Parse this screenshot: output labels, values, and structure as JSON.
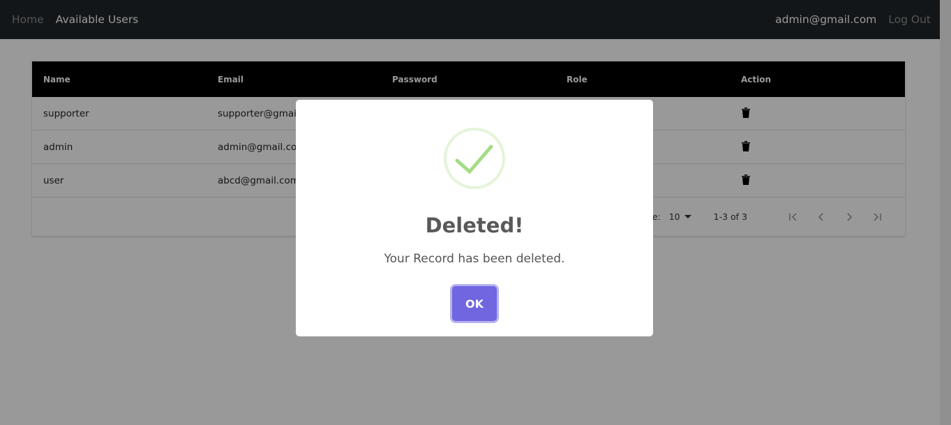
{
  "nav": {
    "home": "Home",
    "available_users": "Available Users",
    "user_email": "admin@gmail.com",
    "logout": "Log Out"
  },
  "table": {
    "headers": [
      "Name",
      "Email",
      "Password",
      "Role",
      "Action"
    ],
    "rows": [
      {
        "name": "supporter",
        "email": "supporter@gmail",
        "action_icon": "trash-icon"
      },
      {
        "name": "admin",
        "email": "admin@gmail.com",
        "action_icon": "trash-icon"
      },
      {
        "name": "user",
        "email": "abcd@gmail.com",
        "action_icon": "trash-icon"
      }
    ],
    "pager": {
      "rows_per_page_label": "er page:",
      "rows_per_page_value": "10",
      "range": "1-3 of 3",
      "buttons": [
        "first-page-icon",
        "previous-page-icon",
        "next-page-icon",
        "last-page-icon"
      ]
    }
  },
  "modal": {
    "icon": "check-icon",
    "title": "Deleted!",
    "text": "Your Record has been deleted.",
    "ok_label": "OK"
  },
  "colors": {
    "navbar": "#212529",
    "table_header": "#000000",
    "ok_button": "#7066e0",
    "success": "#a5dc86"
  }
}
